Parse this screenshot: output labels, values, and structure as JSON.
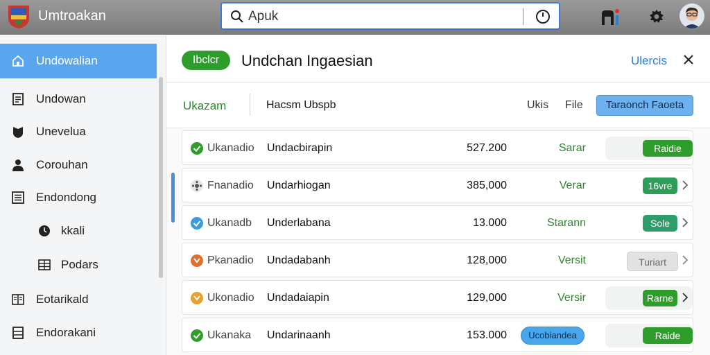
{
  "app": {
    "title": "Umtroakan"
  },
  "search": {
    "value": "Apuk",
    "placeholder": ""
  },
  "sidebar": {
    "items": [
      {
        "label": "Undowalian",
        "icon": "home-icon",
        "active": true
      },
      {
        "label": "Undowan",
        "icon": "document-icon"
      },
      {
        "label": "Unevelua",
        "icon": "shield-icon"
      },
      {
        "label": "Corouhan",
        "icon": "person-icon"
      },
      {
        "label": "Endondong",
        "icon": "list-icon"
      },
      {
        "label": "kkali",
        "icon": "clock-icon"
      },
      {
        "label": "Podars",
        "icon": "grid-icon"
      },
      {
        "label": "Eotarikald",
        "icon": "columns-icon"
      },
      {
        "label": "Endorakani",
        "icon": "table-icon"
      }
    ]
  },
  "header": {
    "badge": "Ibclcr",
    "title": "Undchan Ingaesian",
    "action": "Ulercis"
  },
  "toolbar": {
    "tab": "Ukazam",
    "subtitle": "Hacsm Ubspb",
    "ukis": "Ukis",
    "file": "File",
    "primary": "Taraonch Faoeta"
  },
  "rows": [
    {
      "icon": "check-circle-icon",
      "icon_color": "#2e9d2b",
      "name": "Ukanadio",
      "desc": "Undacbirapin",
      "amount": "527.200",
      "status": "Sarar",
      "button": "Raidie",
      "button_color": "#2e9d2b"
    },
    {
      "icon": "gear-circle-icon",
      "icon_color": "#555555",
      "name": "Fnanadio",
      "desc": "Undarhiogan",
      "amount": "385,000",
      "status": "Verar",
      "button": "16vre",
      "button_color": "#2e9d5a"
    },
    {
      "icon": "check-circle-icon",
      "icon_color": "#3a9be0",
      "name": "Ukanadb",
      "desc": "Underlabana",
      "amount": "13.000",
      "status": "Starann",
      "button": "Sole",
      "button_color": "#2e9d6a"
    },
    {
      "icon": "warning-circle-icon",
      "icon_color": "#e0702e",
      "name": "Pkanadio",
      "desc": "Undadabanh",
      "amount": "128,000",
      "status": "Versit",
      "button": "Turiart",
      "button_color": "#dedede"
    },
    {
      "icon": "warning-circle-icon",
      "icon_color": "#e8a030",
      "name": "Ukonadio",
      "desc": "Undadaiapin",
      "amount": "129,000",
      "status": "Versir",
      "button": "Rarne",
      "button_color": "#2e9d2b"
    },
    {
      "icon": "check-circle-icon",
      "icon_color": "#2e9d2b",
      "name": "Ukanaka",
      "desc": "Undarinaanh",
      "amount": "153.000",
      "status": "",
      "extra": "Ucobiandea",
      "button": "Raide",
      "button_color": "#2e9d2b"
    }
  ]
}
